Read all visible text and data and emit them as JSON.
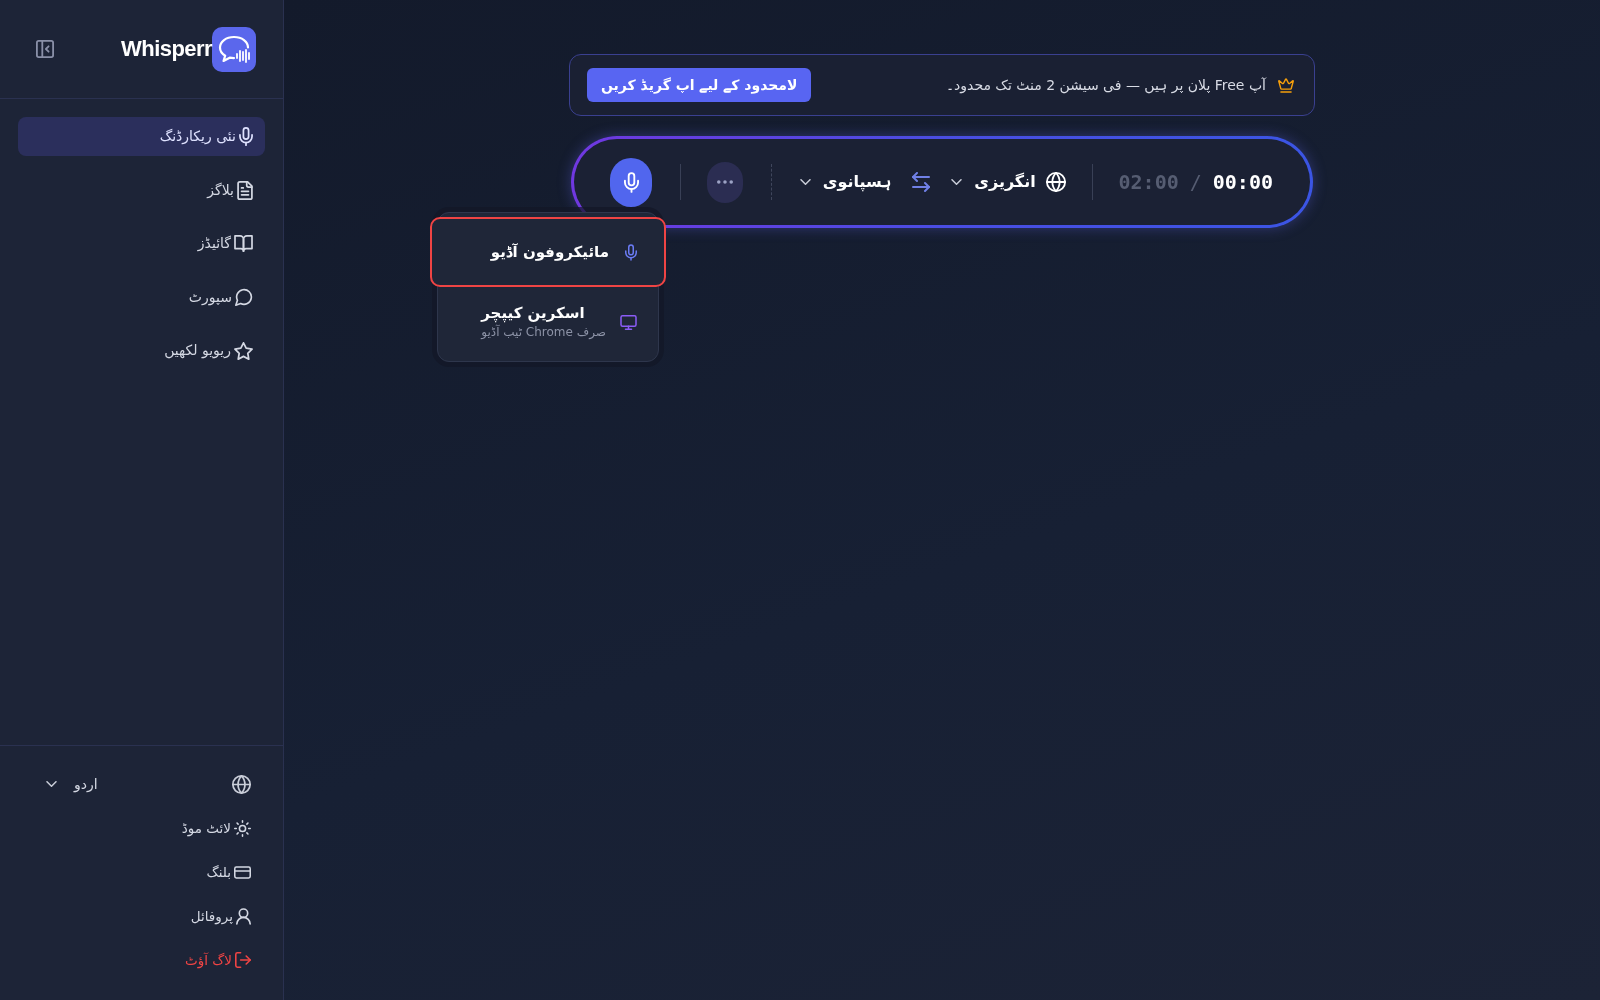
{
  "sidebar": {
    "logo": {
      "text": "Whisperr"
    },
    "nav_items": [
      {
        "label": "نئی ریکارڈنگ",
        "selected": true
      },
      {
        "label": "بلاگز",
        "selected": false
      },
      {
        "label": "گائیڈز",
        "selected": false
      },
      {
        "label": "سپورٹ",
        "selected": false
      },
      {
        "label": "ریویو لکھیں",
        "selected": false
      }
    ],
    "language": {
      "value": "اردو"
    },
    "footer_items": [
      {
        "label": "لائٹ موڈ",
        "kind": "link"
      },
      {
        "label": "بلنگ",
        "kind": "link"
      },
      {
        "label": "پروفائل",
        "kind": "link"
      },
      {
        "label": "لاگ آؤٹ",
        "kind": "danger"
      }
    ]
  },
  "plan_banner": {
    "message": "آپ Free پلان پر ہیں — فی سیشن 2 منٹ تک محدود۔",
    "upgrade_button": "لامحدود کے لیے اپ گریڈ کریں"
  },
  "recorder": {
    "elapsed": "00:00",
    "separator": "/",
    "limit": "02:00",
    "source_language": "انگریزی",
    "target_language": "ہسپانوی",
    "source_menu": {
      "items": [
        {
          "title": "مائیکروفون آڈیو",
          "selected": true
        },
        {
          "title": "اسکرین کیپچر",
          "subtitle": "صرف Chrome ٹیب آڈیو",
          "selected": false
        }
      ]
    }
  }
}
